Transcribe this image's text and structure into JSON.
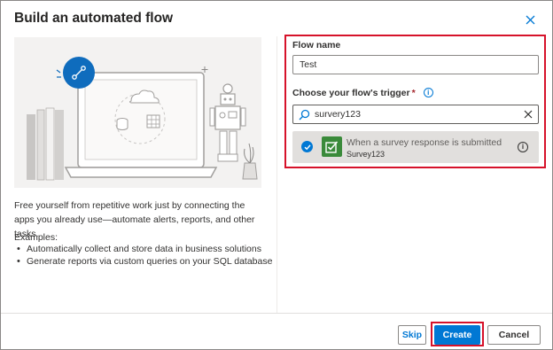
{
  "dialog": {
    "title": "Build an automated flow",
    "close_icon": "close-icon"
  },
  "left": {
    "description": "Free yourself from repetitive work just by connecting the apps you already use—automate alerts, reports, and other tasks.",
    "examples_label": "Examples:",
    "examples": [
      "Automatically collect and store data in business solutions",
      "Generate reports via custom queries on your SQL database"
    ]
  },
  "form": {
    "flow_name_label": "Flow name",
    "flow_name_value": "Test",
    "trigger_label": "Choose your flow's trigger",
    "required_mark": "*",
    "info_glyph": "i",
    "search_value": "survery123",
    "trigger_option": {
      "name": "When a survey response is submitted",
      "connector": "Survey123",
      "selected": true
    }
  },
  "footer": {
    "skip_label": "Skip",
    "create_label": "Create",
    "cancel_label": "Cancel"
  },
  "colors": {
    "accent": "#0078d4",
    "highlight": "#d6122a",
    "app_icon": "#3a8a3a"
  }
}
